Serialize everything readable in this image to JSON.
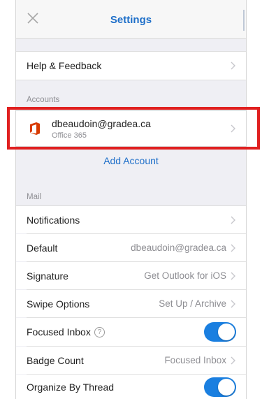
{
  "header": {
    "title": "Settings",
    "close_icon": "close-icon"
  },
  "help_row": {
    "label": "Help & Feedback"
  },
  "accounts_section": {
    "label": "Accounts",
    "account": {
      "email": "dbeaudoin@gradea.ca",
      "type": "Office 365",
      "icon": "office-365-icon"
    },
    "add_label": "Add Account"
  },
  "mail_section": {
    "label": "Mail",
    "rows": {
      "notifications": {
        "label": "Notifications"
      },
      "default": {
        "label": "Default",
        "value": "dbeaudoin@gradea.ca"
      },
      "signature": {
        "label": "Signature",
        "value": "Get Outlook for iOS"
      },
      "swipe": {
        "label": "Swipe Options",
        "value": "Set Up / Archive"
      },
      "focused": {
        "label": "Focused Inbox",
        "help": "?",
        "on": true
      },
      "badge": {
        "label": "Badge Count",
        "value": "Focused Inbox"
      },
      "thread": {
        "label": "Organize By Thread",
        "on": true
      }
    }
  },
  "colors": {
    "accent": "#1e6fc9",
    "toggle_on": "#1a7fe0",
    "highlight": "#e02020",
    "office": "#d83b01"
  }
}
